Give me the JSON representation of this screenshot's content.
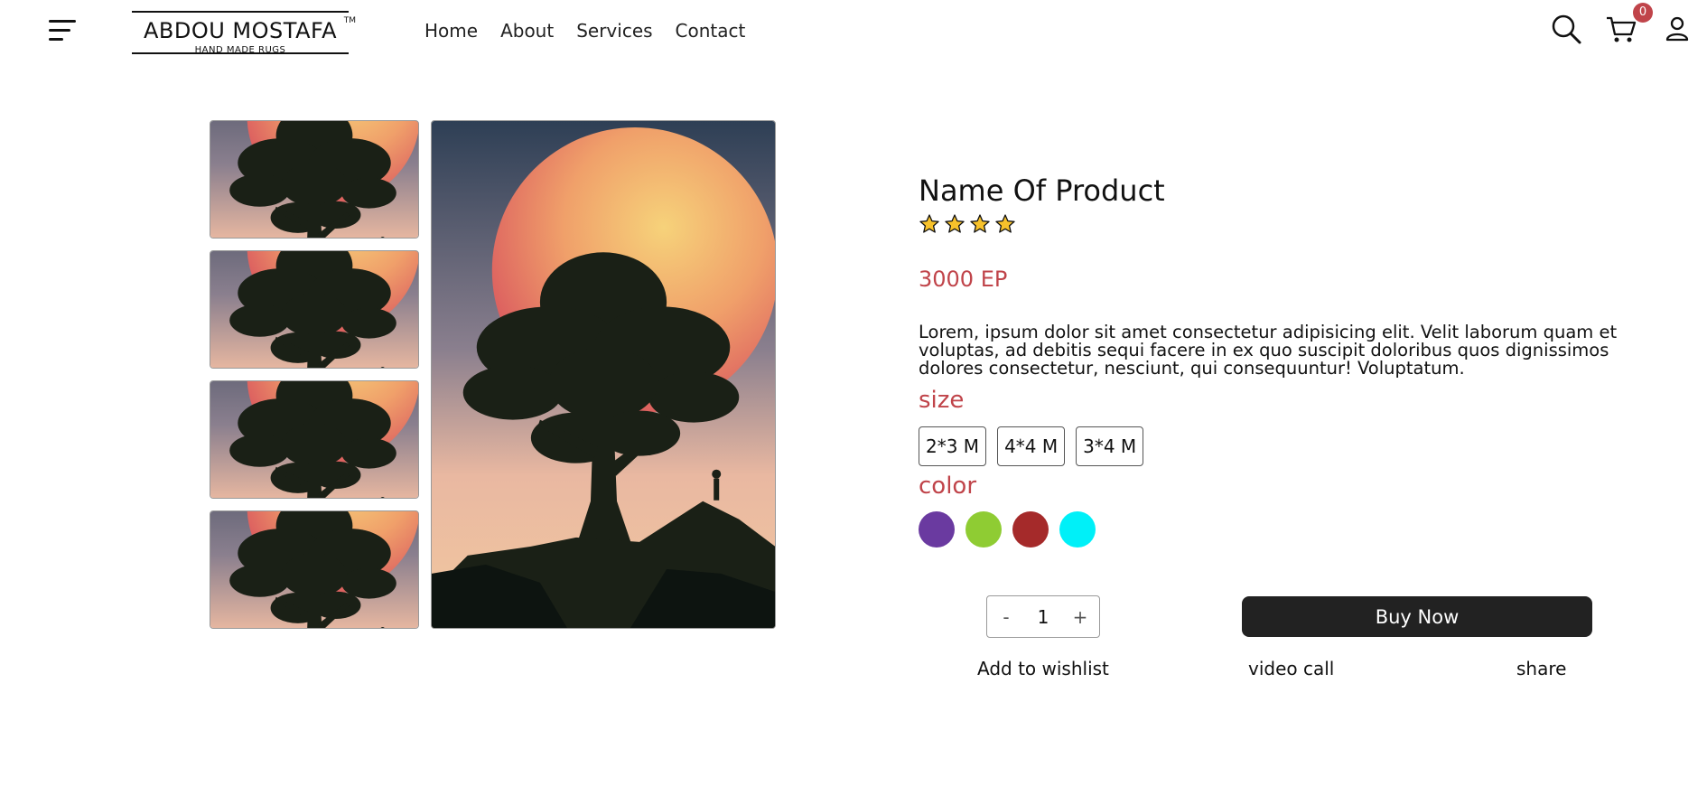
{
  "header": {
    "logo": {
      "brand": "ABDOU MOSTAFA",
      "tm": "TM",
      "tagline": "HAND MADE RUGS"
    },
    "nav": [
      "Home",
      "About",
      "Services",
      "Contact"
    ],
    "icons": [
      "search-icon",
      "cart-icon",
      "user-icon"
    ],
    "cart_count": "0"
  },
  "product": {
    "name": "Name Of Product",
    "rating": 4,
    "price": "3000 EP",
    "description": "Lorem, ipsum dolor sit amet consectetur adipisicing elit. Velit laborum quam et voluptas, ad debitis sequi facere in ex quo suscipit doloribus quos dignissimos dolores consectetur, nesciunt, qui consequuntur! Voluptatum.",
    "size_label": "size",
    "sizes": [
      "2*3 M",
      "4*4 M",
      "3*4 M"
    ],
    "color_label": "color",
    "colors": [
      "#6a3aa0",
      "#8fcc33",
      "#a52a2a",
      "#00f0f8"
    ],
    "quantity": "1",
    "minus": "-",
    "plus": "+",
    "buy_label": "Buy Now",
    "actions": [
      "Add to wishlist",
      "video call",
      "share"
    ]
  },
  "gallery": {
    "thumb_count": 4
  },
  "theme": {
    "accent": "#c0444a",
    "dark": "#222222"
  }
}
